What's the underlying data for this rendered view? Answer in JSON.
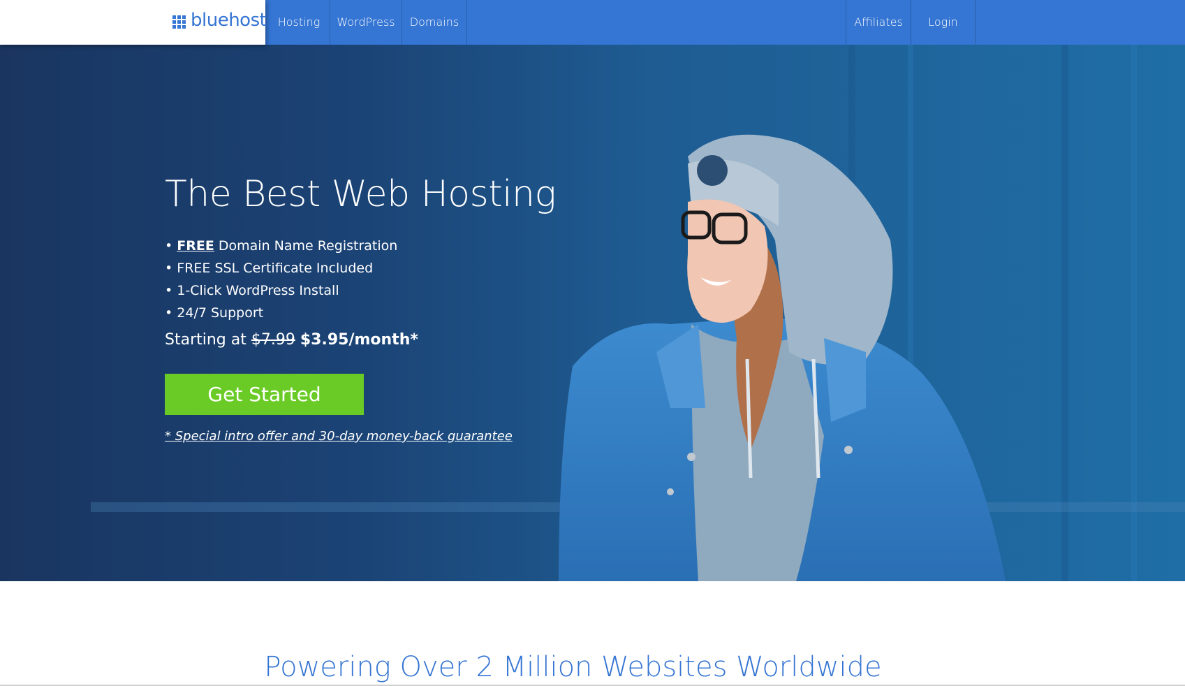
{
  "colors": {
    "brand_blue": "#3575d3",
    "cta_green": "#6acb26",
    "hero_dark": "#1a3560",
    "hero_light": "#1f6fa6"
  },
  "logo": {
    "icon": "grid-icon",
    "text": "bluehost"
  },
  "nav": {
    "left_items": [
      "Hosting",
      "WordPress",
      "Domains"
    ],
    "right_items": [
      "Affiliates",
      "Login"
    ]
  },
  "hero": {
    "title": "The Best Web Hosting",
    "bullet": "•",
    "features": [
      {
        "highlight": "FREE",
        "text": "Domain Name Registration"
      },
      {
        "text": "FREE SSL Certificate Included"
      },
      {
        "text": "1-Click WordPress Install"
      },
      {
        "text": "24/7 Support"
      }
    ],
    "price": {
      "prefix": "Starting at",
      "old": "$7.99",
      "new": "$3.95/month*"
    },
    "cta_label": "Get Started",
    "guarantee": "* Special intro offer and 30-day money-back guarantee"
  },
  "section": {
    "heading": "Powering Over 2 Million Websites Worldwide"
  }
}
